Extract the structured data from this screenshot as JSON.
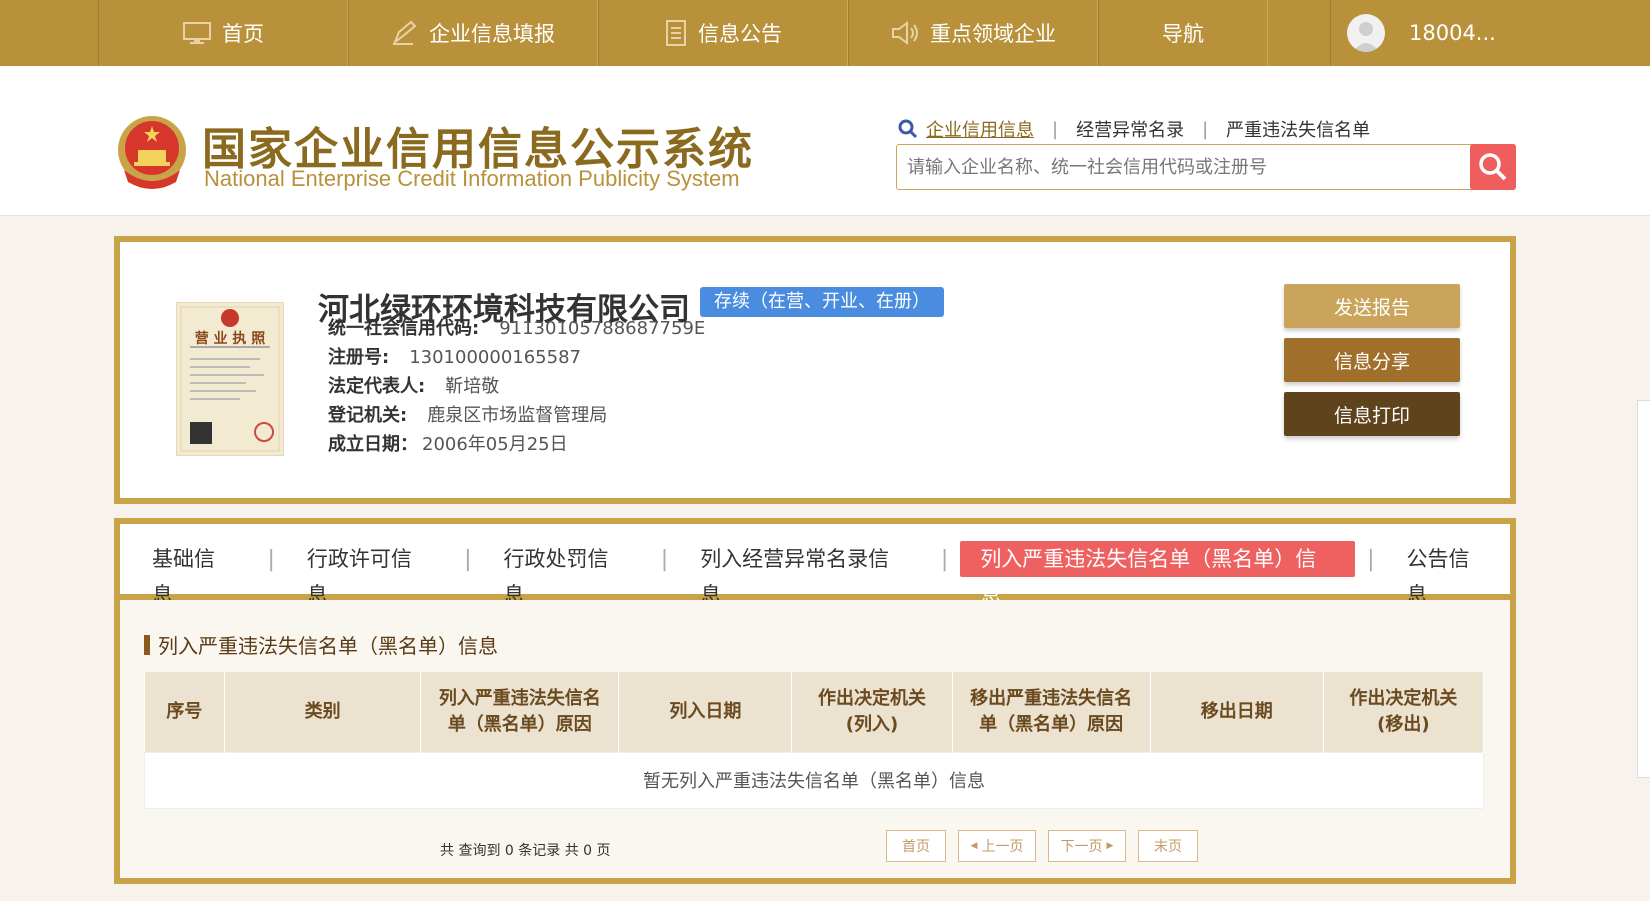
{
  "topnav": {
    "items": [
      {
        "label": "首页",
        "icon": "monitor-icon"
      },
      {
        "label": "企业信息填报",
        "icon": "pen-icon"
      },
      {
        "label": "信息公告",
        "icon": "document-icon"
      },
      {
        "label": "重点领域企业",
        "icon": "speaker-icon"
      },
      {
        "label": "导航"
      }
    ],
    "user": "18004..."
  },
  "header": {
    "title_cn": "国家企业信用信息公示系统",
    "title_en": "National Enterprise Credit Information Publicity System",
    "search_tabs": [
      "企业信用信息",
      "经营异常名录",
      "严重违法失信名单"
    ],
    "search_placeholder": "请输入企业名称、统一社会信用代码或注册号"
  },
  "company": {
    "name": "河北绿环环境科技有限公司",
    "status": "存续（在营、开业、在册）",
    "fields": [
      {
        "label": "统一社会信用代码:",
        "value": "91130105788687759E"
      },
      {
        "label": "注册号:",
        "value": "130100000165587"
      },
      {
        "label": "法定代表人:",
        "value": "靳培敬"
      },
      {
        "label": "登记机关:",
        "value": "鹿泉区市场监督管理局"
      },
      {
        "label": "成立日期：",
        "value": "2006年05月25日"
      }
    ],
    "license_title": "营 业 执 照",
    "actions": [
      {
        "label": "发送报告",
        "color": "#c9a45a"
      },
      {
        "label": "信息分享",
        "color": "#a0702a"
      },
      {
        "label": "信息打印",
        "color": "#5f431c"
      }
    ]
  },
  "tabs": {
    "items": [
      "基础信息",
      "行政许可信息",
      "行政处罚信息",
      "列入经营异常名录信息",
      "列入严重违法失信名单（黑名单）信息",
      "公告信息"
    ],
    "active_index": 4
  },
  "section": {
    "title": "列入严重违法失信名单（黑名单）信息",
    "columns": [
      "序号",
      "类别",
      "列入严重违法失信名单（黑名单）原因",
      "列入日期",
      "作出决定机关(列入)",
      "移出严重违法失信名单（黑名单）原因",
      "移出日期",
      "作出决定机关(移出)"
    ],
    "empty_text": "暂无列入严重违法失信名单（黑名单）信息"
  },
  "pager": {
    "summary": "共 查询到 0 条记录 共 0 页",
    "first": "首页",
    "prev": "上一页",
    "next": "下一页",
    "last": "末页"
  }
}
